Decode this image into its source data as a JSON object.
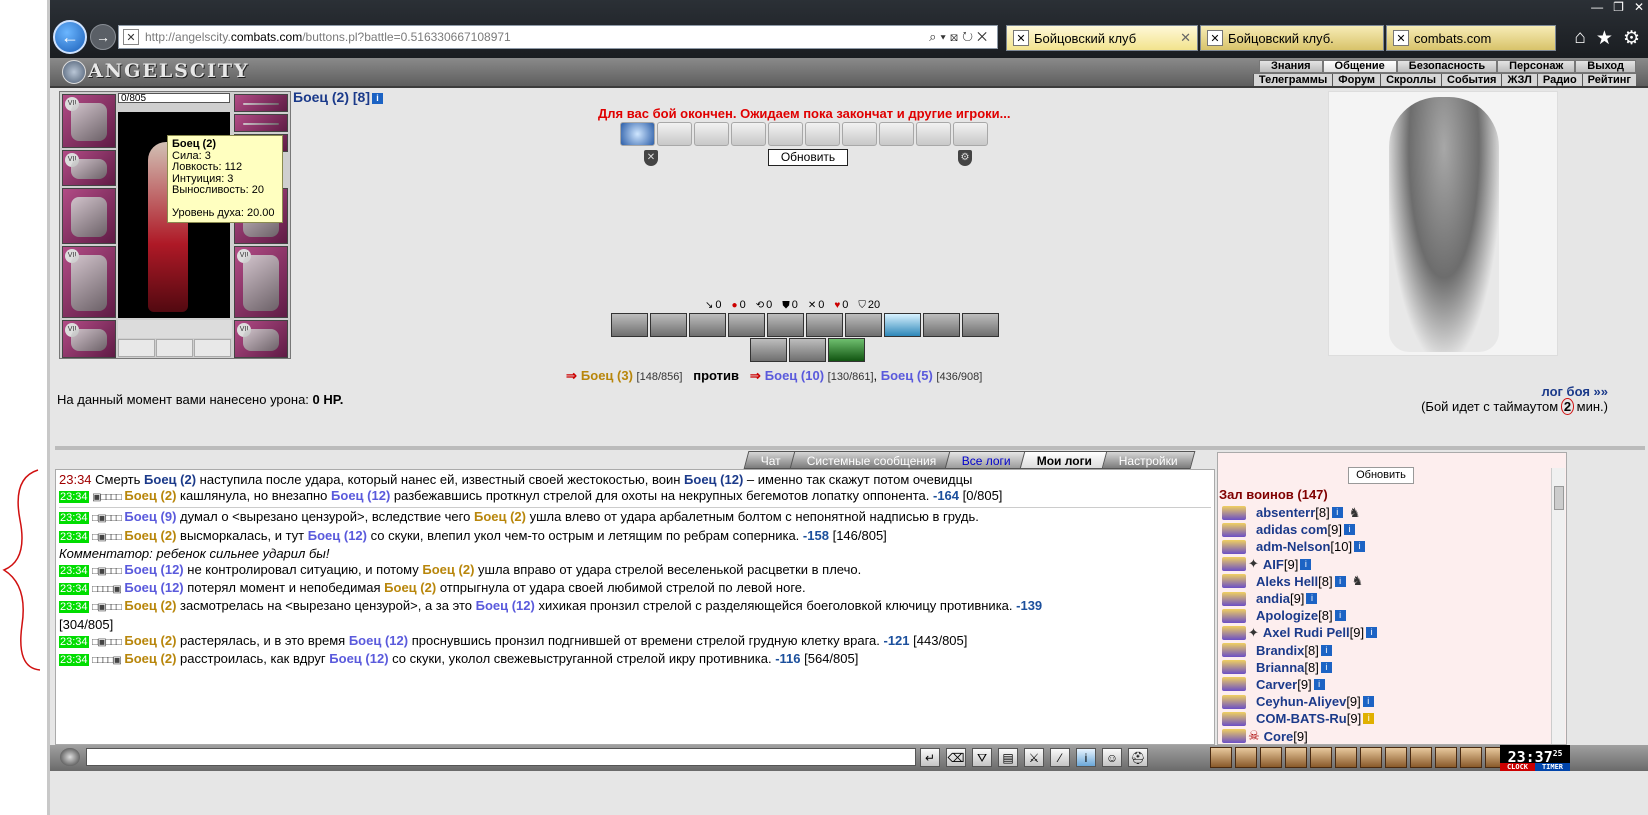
{
  "browser": {
    "url_prefix": "http://angelscity.",
    "url_host": "combats.com",
    "url_path": "/buttons.pl?battle=0.516330667108971",
    "tabs": [
      {
        "label": "Бойцовский клуб",
        "active": true
      },
      {
        "label": "Бойцовский клуб."
      },
      {
        "label": "combats.com"
      }
    ]
  },
  "header": {
    "logo": "ANGELSCITY",
    "menu_top": [
      "Знания",
      "Общение",
      "Безопасность",
      "Персонаж",
      "Выход"
    ],
    "menu_bottom": [
      "Телеграммы",
      "Форум",
      "Скроллы",
      "События",
      "ЖЗЛ",
      "Радио",
      "Рейтинг"
    ]
  },
  "character": {
    "hp": "0/805",
    "name": "Боец (2) [8]",
    "tooltip": {
      "title": "Боец (2)",
      "strength": "Сила: 3",
      "agility": "Ловкость: 112",
      "intuition": "Интуиция: 3",
      "endurance": "Выносливость: 20",
      "spirit": "Уровень духа: 20.00"
    }
  },
  "battle": {
    "message": "Для вас бой окончен. Ожидаем пока закончат и другие игроки...",
    "refresh_label": "Обновить",
    "stats": [
      "0",
      "0",
      "0",
      "0",
      "0",
      "0",
      "20"
    ],
    "team1": {
      "name": "Боец (3)",
      "hp": "[148/856]"
    },
    "vs_label": "против",
    "team2": [
      {
        "name": "Боец (10)",
        "hp": "[130/861]"
      },
      {
        "name": "Боец (5)",
        "hp": "[436/908]"
      }
    ],
    "damage_prefix": "На данный момент вами нанесено урона:",
    "damage_value": "0 HP.",
    "log_link": "лог боя »»",
    "timeout_prefix": "(Бой идет с таймаутом",
    "timeout_value": "2",
    "timeout_suffix": "мин.)"
  },
  "log_tabs": [
    "Чат",
    "Системные сообщения",
    "Все логи",
    "Мои логи",
    "Настройки"
  ],
  "log": {
    "l1": {
      "time": "23:34",
      "a": "Смерть",
      "b": "Боец (2)",
      "c": "наступила после удара, который нанес ей, известный своей жестокостью, воин",
      "d": "Боец (12)",
      "e": "– именно так скажут потом очевидцы"
    },
    "l2": {
      "time": "23:34",
      "a": "Боец (2)",
      "b": "кашлянула, но внезапно",
      "c": "Боец (12)",
      "d": "разбежавшись проткнул стрелой для охоты на некрупных бегемотов лопатку оппонента.",
      "dmg": "-164",
      "hp": "[0/805]"
    },
    "l3": {
      "time": "23:34",
      "a": "Боец (9)",
      "b": "думал о <вырезано цензурой>, вследствие чего",
      "c": "Боец (2)",
      "d": "ушла влево от удара арбалетным болтом с непонятной надписью в грудь."
    },
    "l4": {
      "time": "23:34",
      "a": "Боец (2)",
      "b": "высморкалась, и тут",
      "c": "Боец (12)",
      "d": "со скуки, влепил укол чем-то острым и летящим по ребрам соперника.",
      "dmg": "-158",
      "hp": "[146/805]"
    },
    "comment": "Комментатор: ребенок сильнее ударил бы!",
    "l5": {
      "time": "23:34",
      "a": "Боец (12)",
      "b": "не контролировал ситуацию, и потому",
      "c": "Боец (2)",
      "d": "ушла вправо от удара стрелой веселенькой расцветки в плечо."
    },
    "l6": {
      "time": "23:34",
      "a": "Боец (12)",
      "b": "потерял момент и непобедимая",
      "c": "Боец (2)",
      "d": "отпрыгнула от удара своей любимой стрелой по левой ноге."
    },
    "l7": {
      "time": "23:34",
      "a": "Боец (2)",
      "b": "засмотрелась на <вырезано цензурой>, а за это",
      "c": "Боец (12)",
      "d": "хихикая пронзил стрелой с разделяющейся боеголовкой ключицу противника.",
      "dmg": "-139",
      "hp": "[304/805]"
    },
    "l8": {
      "time": "23:34",
      "a": "Боец (2)",
      "b": "растерялась, и в это время",
      "c": "Боец (12)",
      "d": "проснувшись пронзил подгнившей от времени стрелой грудную клетку врага.",
      "dmg": "-121",
      "hp": "[443/805]"
    },
    "l9": {
      "time": "23:34",
      "a": "Боец (2)",
      "b": "расстроилась, как вдруг",
      "c": "Боец (12)",
      "d": "со скуки, уколол свежевыструганной стрелой икру противника.",
      "dmg": "-116",
      "hp": "[564/805]"
    }
  },
  "warriors": {
    "refresh_label": "Обновить",
    "title": "Зал воинов (147)",
    "list": [
      {
        "name": "absenterr",
        "lvl": "[8]"
      },
      {
        "name": "adidas com",
        "lvl": "[9]"
      },
      {
        "name": "adm-Nelson",
        "lvl": "[10]"
      },
      {
        "name": "AIF",
        "lvl": "[9]"
      },
      {
        "name": "Aleks Hell",
        "lvl": "[8]"
      },
      {
        "name": "andia",
        "lvl": "[9]"
      },
      {
        "name": "Apologize",
        "lvl": "[8]"
      },
      {
        "name": "Axel Rudi Pell",
        "lvl": "[9]"
      },
      {
        "name": "Brandix",
        "lvl": "[8]"
      },
      {
        "name": "Brianna",
        "lvl": "[8]"
      },
      {
        "name": "Carver",
        "lvl": "[9]"
      },
      {
        "name": "Ceyhun-Aliyev",
        "lvl": "[9]"
      },
      {
        "name": "COM-BATS-Ru",
        "lvl": "[9]"
      },
      {
        "name": "Core",
        "lvl": "[9]"
      }
    ]
  },
  "clock": {
    "time": "23:37",
    "seconds": "25",
    "label1": "CLOCK",
    "label2": "TIMER"
  }
}
